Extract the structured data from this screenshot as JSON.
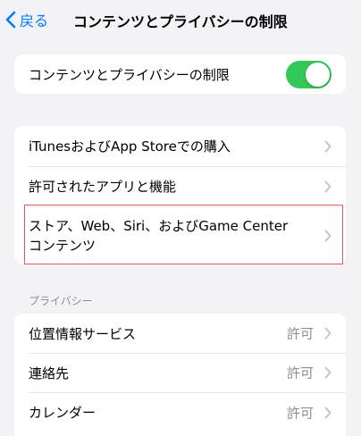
{
  "navbar": {
    "back_label": "戻る",
    "title": "コンテンツとプライバシーの制限"
  },
  "toggle_group": {
    "label": "コンテンツとプライバシーの制限",
    "enabled": true
  },
  "restrictions": [
    {
      "label": "iTunesおよびApp Storeでの購入"
    },
    {
      "label": "許可されたアプリと機能"
    },
    {
      "label_line1": "ストア、Web、Siri、およびGame Center",
      "label_line2": "コンテンツ"
    }
  ],
  "privacy": {
    "header": "プライバシー",
    "items": [
      {
        "label": "位置情報サービス",
        "value": "許可"
      },
      {
        "label": "連絡先",
        "value": "許可"
      },
      {
        "label": "カレンダー",
        "value": "許可"
      }
    ]
  },
  "colors": {
    "accent": "#007aff",
    "toggle_on": "#34c759",
    "background": "#f2f2f7",
    "highlight_border": "#e35a5a",
    "secondary_text": "#8e8e93"
  },
  "icons": {
    "back": "chevron-left-icon",
    "disclosure": "chevron-right-icon"
  }
}
